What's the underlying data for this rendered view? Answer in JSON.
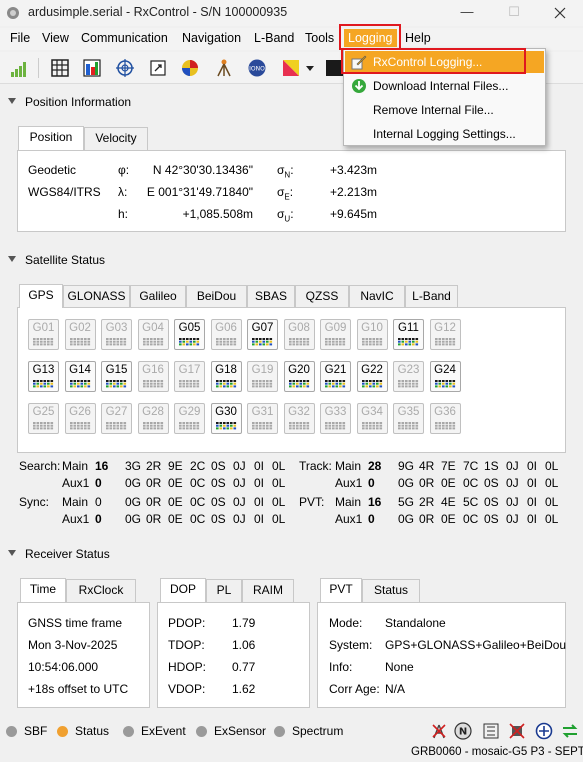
{
  "window": {
    "title": "ardusimple.serial - RxControl - S/N 100000935",
    "minimize": "—",
    "maximize": "☐"
  },
  "menu": {
    "file": "File",
    "view": "View",
    "communication": "Communication",
    "navigation": "Navigation",
    "lband": "L-Band",
    "tools": "Tools",
    "logging": "Logging",
    "help": "Help"
  },
  "logging_menu": {
    "rxcontrol_logging": "RxControl Logging...",
    "download_internal": "Download Internal Files...",
    "remove_internal": "Remove Internal File...",
    "internal_settings": "Internal Logging Settings..."
  },
  "position": {
    "section_title": "Position Information",
    "tabs": [
      "Position",
      "Velocity"
    ],
    "geodetic": "Geodetic",
    "datum": "WGS84/ITRS",
    "phi_label": "φ:",
    "lambda_label": "λ:",
    "h_label": "h:",
    "phi": "N 42°30'30.13436\"",
    "lambda": "E 001°31'49.71840\"",
    "h": "+1,085.508m",
    "sigma_n_label": "σ",
    "sigma_n_sub": "N",
    "sigma_e_sub": "E",
    "sigma_u_sub": "U",
    "sigma_n": "+3.423m",
    "sigma_e": "+2.213m",
    "sigma_u": "+9.645m"
  },
  "satellite": {
    "section_title": "Satellite Status",
    "tabs": [
      "GPS",
      "GLONASS",
      "Galileo",
      "BeiDou",
      "SBAS",
      "QZSS",
      "NavIC",
      "L-Band"
    ],
    "rows": [
      [
        "G01",
        "G02",
        "G03",
        "G04",
        "G05",
        "G06",
        "G07",
        "G08",
        "G09",
        "G10",
        "G11",
        "G12"
      ],
      [
        "G13",
        "G14",
        "G15",
        "G16",
        "G17",
        "G18",
        "G19",
        "G20",
        "G21",
        "G22",
        "G23",
        "G24"
      ],
      [
        "G25",
        "G26",
        "G27",
        "G28",
        "G29",
        "G30",
        "G31",
        "G32",
        "G33",
        "G34",
        "G35",
        "G36"
      ]
    ],
    "active": [
      "G05",
      "G07",
      "G11",
      "G13",
      "G14",
      "G15",
      "G18",
      "G20",
      "G21",
      "G22",
      "G24",
      "G30"
    ],
    "search_label": "Search:",
    "sync_label": "Sync:",
    "track_label": "Track:",
    "pvt_label": "PVT:",
    "main": "Main",
    "aux1": "Aux1",
    "search_main": [
      "16",
      "3G",
      "2R",
      "9E",
      "2C",
      "0S",
      "0J",
      "0I",
      "0L"
    ],
    "search_aux1": [
      "0",
      "0G",
      "0R",
      "0E",
      "0C",
      "0S",
      "0J",
      "0I",
      "0L"
    ],
    "sync_main": [
      "0",
      "0G",
      "0R",
      "0E",
      "0C",
      "0S",
      "0J",
      "0I",
      "0L"
    ],
    "sync_aux1": [
      "0",
      "0G",
      "0R",
      "0E",
      "0C",
      "0S",
      "0J",
      "0I",
      "0L"
    ],
    "track_main": [
      "28",
      "9G",
      "4R",
      "7E",
      "7C",
      "1S",
      "0J",
      "0I",
      "0L"
    ],
    "track_aux1": [
      "0",
      "0G",
      "0R",
      "0E",
      "0C",
      "0S",
      "0J",
      "0I",
      "0L"
    ],
    "pvt_main": [
      "16",
      "5G",
      "2R",
      "4E",
      "5C",
      "0S",
      "0J",
      "0I",
      "0L"
    ],
    "pvt_aux1": [
      "0",
      "0G",
      "0R",
      "0E",
      "0C",
      "0S",
      "0J",
      "0I",
      "0L"
    ]
  },
  "receiver": {
    "section_title": "Receiver Status",
    "time_tabs": [
      "Time",
      "RxClock"
    ],
    "time_frame": "GNSS time frame",
    "date": "Mon 3-Nov-2025",
    "time": "10:54:06.000",
    "offset": "+18s offset to UTC",
    "dop_tabs": [
      "DOP",
      "PL",
      "RAIM"
    ],
    "pdop_label": "PDOP:",
    "tdop_label": "TDOP:",
    "hdop_label": "HDOP:",
    "vdop_label": "VDOP:",
    "pdop": "1.79",
    "tdop": "1.06",
    "hdop": "0.77",
    "vdop": "1.62",
    "pvt_tabs": [
      "PVT",
      "Status"
    ],
    "mode_label": "Mode:",
    "system_label": "System:",
    "info_label": "Info:",
    "corr_label": "Corr Age:",
    "mode": "Standalone",
    "system": "GPS+GLONASS+Galileo+BeiDou",
    "info": "None",
    "corr_age": "N/A"
  },
  "statusbar": {
    "items": [
      "SBF",
      "Status",
      "ExEvent",
      "ExSensor",
      "Spectrum"
    ],
    "colors": [
      "#9a9a9a",
      "#f0a030",
      "#9a9a9a",
      "#9a9a9a",
      "#9a9a9a"
    ],
    "receiver_info": "GRB0060 - mosaic-G5 P3 - SEPT"
  }
}
